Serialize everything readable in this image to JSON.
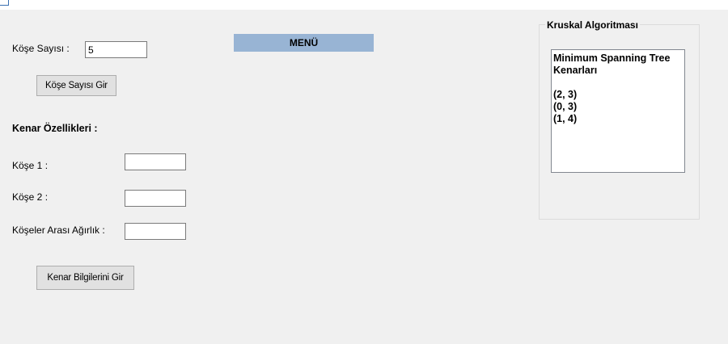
{
  "form": {
    "vertex_count_label": "Köşe Sayısı :",
    "vertex_count_value": "5",
    "vertex_count_button": "Köşe Sayısı Gir",
    "menu_label": "MENÜ",
    "edge_properties_heading": "Kenar Özellikleri :",
    "vertex1_label": "Köşe 1 :",
    "vertex1_value": "",
    "vertex2_label": "Köşe 2 :",
    "vertex2_value": "",
    "weight_label": "Köşeler Arası Ağırlık :",
    "weight_value": "",
    "edge_button": "Kenar Bilgilerini Gir"
  },
  "kruskal": {
    "group_title": "Kruskal Algoritması",
    "list_items": [
      "Minimum Spanning Tree",
      "Kenarları",
      "",
      "(2, 3)",
      "(0, 3)",
      "(1, 4)"
    ]
  }
}
